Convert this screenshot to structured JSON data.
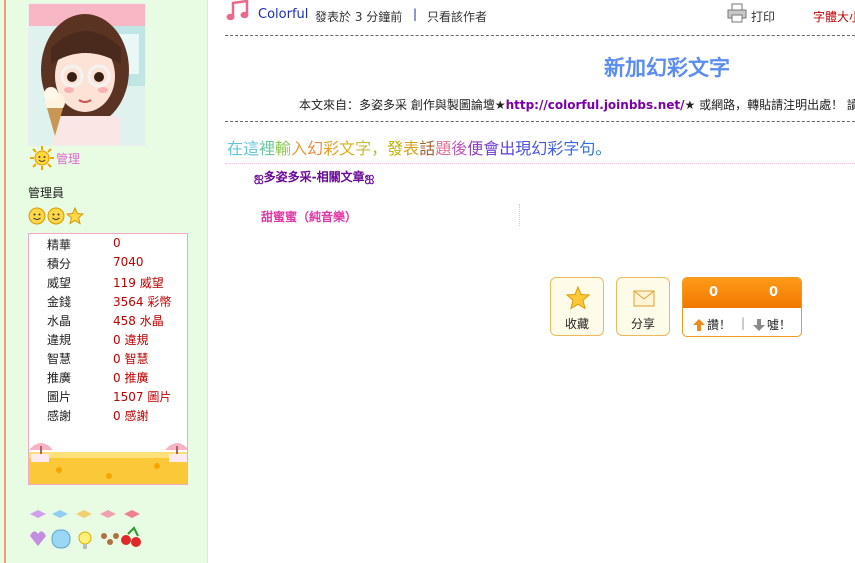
{
  "sidebar": {
    "badge_label": "管理",
    "role": "管理員",
    "stats": [
      {
        "label": "精華",
        "value": "0"
      },
      {
        "label": "積分",
        "value": "7040"
      },
      {
        "label": "威望",
        "value": "119 威望"
      },
      {
        "label": "金錢",
        "value": "3564 彩幣"
      },
      {
        "label": "水晶",
        "value": "458 水晶"
      },
      {
        "label": "違規",
        "value": "0 違規"
      },
      {
        "label": "智慧",
        "value": "0 智慧"
      },
      {
        "label": "推廣",
        "value": "0 推廣"
      },
      {
        "label": "圖片",
        "value": "1507 圖片"
      },
      {
        "label": "感謝",
        "value": "0 感謝"
      }
    ]
  },
  "post": {
    "author": "Colorful",
    "posted": "發表於 3 分鐘前",
    "separator": "|",
    "only_author": "只看該作者",
    "print": "打印",
    "font_size": "字體大小",
    "title": "新加幻彩文字",
    "source_prefix": "本文來自：多姿多采 創作與製圖論壇★",
    "source_url": "http://colorful.joinbbs.net/",
    "source_suffix": "★ 或網路，轉貼請注明出處！ 讀",
    "rainbow_text": "在這裡輸入幻彩文字，發表話題後便會出現幻彩字句。",
    "related_title": "ஐ多姿多采-相關文章ஐ",
    "related_item": "甜蜜蜜（純音樂）"
  },
  "actions": {
    "favorite": "收藏",
    "share": "分享",
    "up_count": "0",
    "down_count": "0",
    "up_label": "讚！",
    "divider": "|",
    "down_label": "噓！"
  },
  "colors": {
    "rainbow": [
      "#5fc4d8",
      "#5fc4d8",
      "#6cc9a0",
      "#8bc750",
      "#e0a040",
      "#f08a3a",
      "#e6a020",
      "#d8b020",
      "#c6b838",
      "#a8b840",
      "#c0b000",
      "#d8a018",
      "#a06030",
      "#e07090",
      "#c058c0",
      "#9040c0",
      "#7040d0",
      "#6040d8",
      "#5050e0",
      "#4858e0",
      "#4060e0",
      "#3868e0",
      "#3070e0",
      "#2878e0"
    ]
  }
}
